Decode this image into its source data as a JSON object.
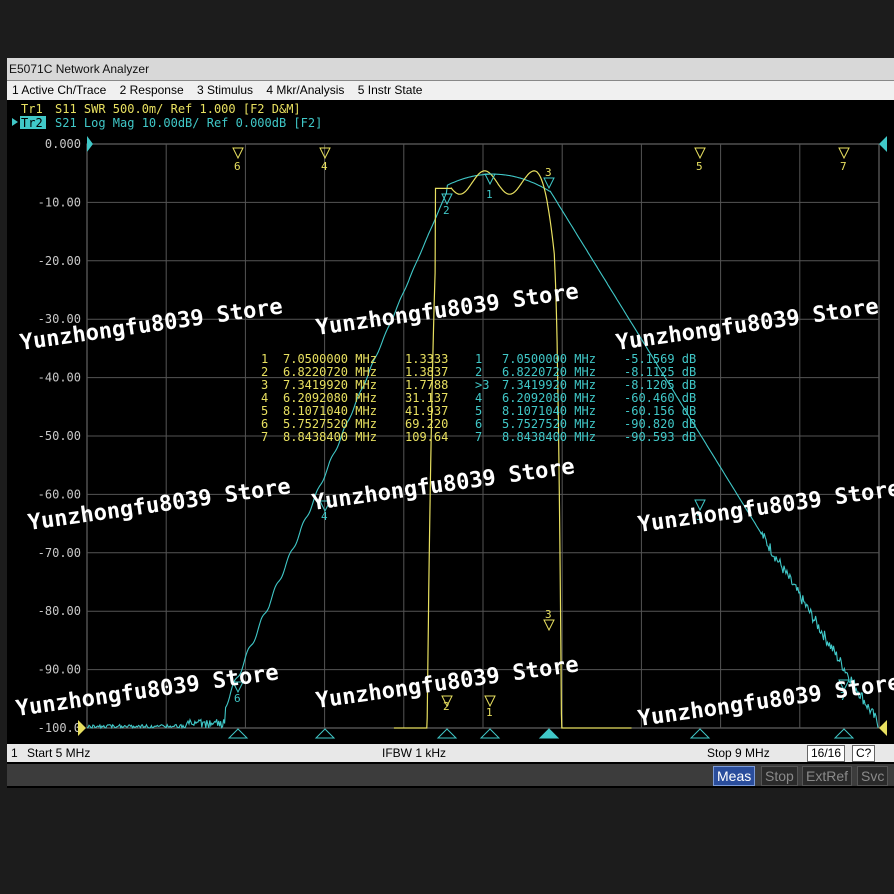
{
  "window": {
    "title": "E5071C Network Analyzer"
  },
  "menu": [
    {
      "label": "1 Active Ch/Trace"
    },
    {
      "label": "2 Response"
    },
    {
      "label": "3 Stimulus"
    },
    {
      "label": "4 Mkr/Analysis"
    },
    {
      "label": "5 Instr State"
    }
  ],
  "traces": {
    "tr1": {
      "label": "Tr1",
      "text": "S11  SWR 500.0m/  Ref 1.000  [F2 D&M]",
      "color": "#e8e060"
    },
    "tr2": {
      "label": "Tr2",
      "text": "S21  Log Mag 10.00dB/  Ref 0.000dB  [F2]",
      "color": "#40c8c8"
    }
  },
  "y_axis_labels": [
    "0.000",
    "-10.00",
    "-20.00",
    "-30.00",
    "-40.00",
    "-50.00",
    "-60.00",
    "-70.00",
    "-80.00",
    "-90.00",
    "-100.0"
  ],
  "markers_top": [
    "6",
    "4",
    "2",
    "1",
    "3",
    "5",
    "7"
  ],
  "marker_table_tr1": [
    {
      "num": "1",
      "freq": "7.0500000 MHz",
      "value": "1.3333"
    },
    {
      "num": "2",
      "freq": "6.8220720 MHz",
      "value": "1.3837"
    },
    {
      "num": "3",
      "freq": "7.3419920 MHz",
      "value": "1.7788"
    },
    {
      "num": "4",
      "freq": "6.2092080 MHz",
      "value": "31.137"
    },
    {
      "num": "5",
      "freq": "8.1071040 MHz",
      "value": "41.937"
    },
    {
      "num": "6",
      "freq": "5.7527520 MHz",
      "value": "69.220"
    },
    {
      "num": "7",
      "freq": "8.8438400 MHz",
      "value": "109.64"
    }
  ],
  "marker_table_tr2": [
    {
      "num": "1",
      "freq": "7.0500000 MHz",
      "value": "-5.1569 dB"
    },
    {
      "num": "2",
      "freq": "6.8220720 MHz",
      "value": "-8.1125 dB"
    },
    {
      "num": ">3",
      "freq": "7.3419920 MHz",
      "value": "-8.1205 dB"
    },
    {
      "num": "4",
      "freq": "6.2092080 MHz",
      "value": "-60.460 dB"
    },
    {
      "num": "5",
      "freq": "8.1071040 MHz",
      "value": "-60.156 dB"
    },
    {
      "num": "6",
      "freq": "5.7527520 MHz",
      "value": "-90.820 dB"
    },
    {
      "num": "7",
      "freq": "8.8438400 MHz",
      "value": "-90.593 dB"
    }
  ],
  "watermark": "Yunzhongfu8039 Store",
  "status": {
    "channel": "1",
    "start": "Start 5 MHz",
    "ifbw": "IFBW 1 kHz",
    "stop": "Stop 9 MHz",
    "points": "16/16",
    "cal": "C?"
  },
  "softkeys": [
    {
      "label": "Meas",
      "active": true
    },
    {
      "label": "Stop",
      "active": false
    },
    {
      "label": "ExtRef",
      "active": false
    },
    {
      "label": "Svc",
      "active": false
    }
  ],
  "colors": {
    "tr1": "#e8e060",
    "tr2": "#40c8c8",
    "grid": "#555555"
  }
}
